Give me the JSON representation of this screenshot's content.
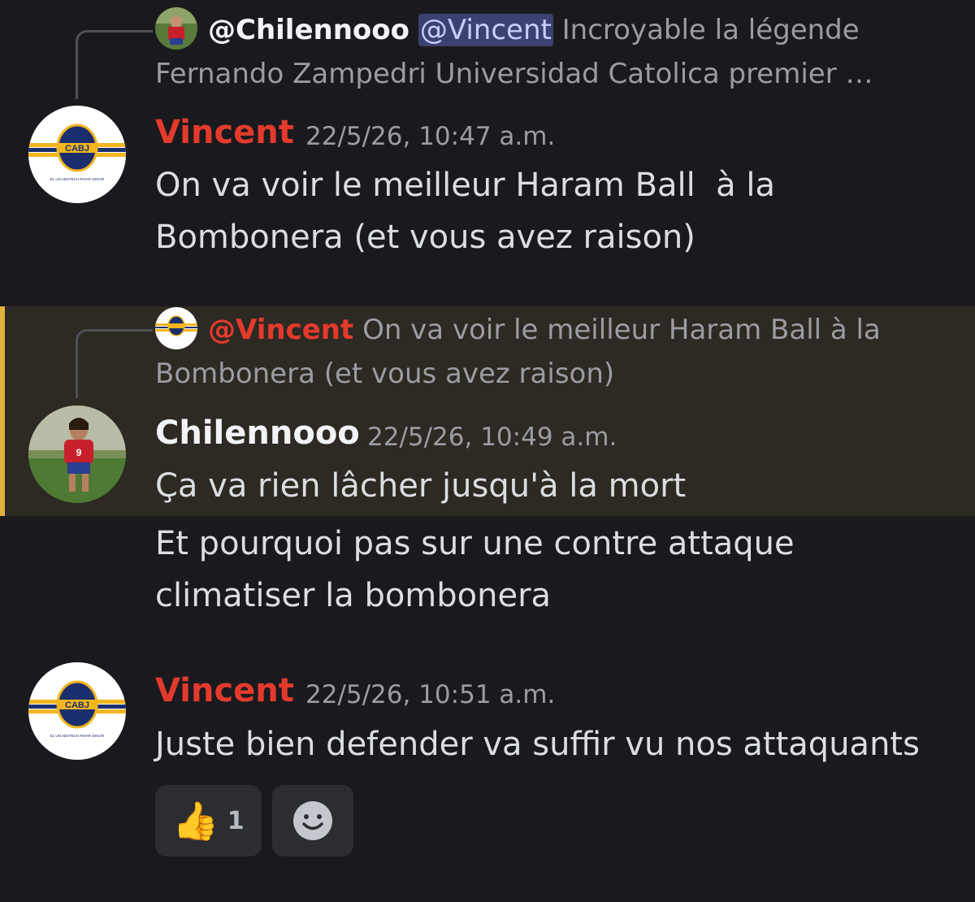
{
  "messages": [
    {
      "reply": {
        "author": "@Chilennooo",
        "mention": "@Vincent",
        "line1": "Incroyable la légende",
        "line2": "Fernando Zampedri Universidad Catolica premier …"
      },
      "username": "Vincent",
      "timestamp": "22/5/26, 10:47 a.m.",
      "text": "On va voir le meilleur Haram Ball  à la\nBombonera (et vous avez raison)"
    },
    {
      "reply": {
        "mention": "@Vincent",
        "line1": "On va voir le meilleur Haram Ball  à la",
        "line2": "Bombonera (et vous avez raison)"
      },
      "username": "Chilennooo",
      "timestamp": "22/5/26, 10:49 a.m.",
      "text": "Ça va rien lâcher jusqu'à la mort",
      "followup": "Et pourquoi pas sur une contre attaque\nclimatiser la bombonera"
    },
    {
      "username": "Vincent",
      "timestamp": "22/5/26, 10:51 a.m.",
      "text": "Juste bien defender va suffir vu nos attaquants",
      "reactions": [
        {
          "emoji": "👍",
          "count": "1"
        },
        {
          "icon": "add-reaction-icon"
        }
      ]
    }
  ],
  "avatars": {
    "vincent_logo_text": "CABJ",
    "vincent_logo_caption": "EL UN ABSTECH RIVAR SINCRI"
  },
  "colors": {
    "background": "#1a1a1e",
    "highlight_bg": "#2d2923",
    "highlight_bar": "#e3b03d",
    "vincent_name": "#e33a2c",
    "mention_chip": "#3c4270",
    "boca_blue": "#1b2f6e",
    "boca_gold": "#f2b51d"
  }
}
